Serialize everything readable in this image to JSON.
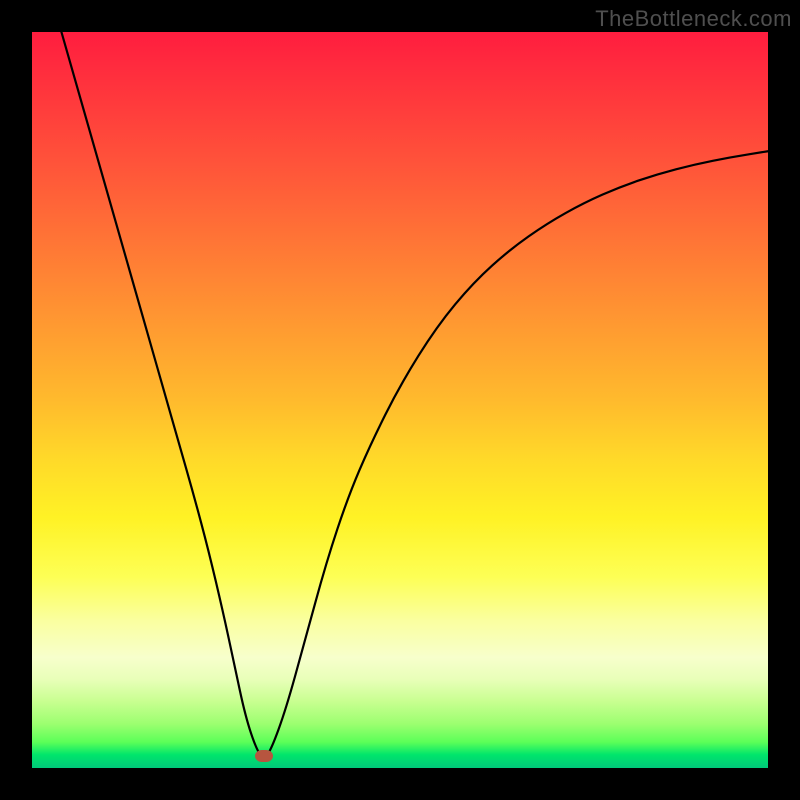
{
  "watermark": "TheBottleneck.com",
  "chart_data": {
    "type": "line",
    "title": "",
    "xlabel": "",
    "ylabel": "",
    "xlim": [
      0,
      100
    ],
    "ylim": [
      0,
      100
    ],
    "grid": false,
    "legend": false,
    "gradient_stops": [
      {
        "pos": 0,
        "color": "#ff1d3f"
      },
      {
        "pos": 50,
        "color": "#ffba2d"
      },
      {
        "pos": 74,
        "color": "#fdff55"
      },
      {
        "pos": 96.5,
        "color": "#5bff58"
      },
      {
        "pos": 100,
        "color": "#00c97a"
      }
    ],
    "series": [
      {
        "name": "bottleneck-curve",
        "x": [
          4,
          6,
          8,
          10,
          12,
          14,
          16,
          18,
          20,
          22,
          24,
          26,
          27.5,
          29,
          30.5,
          31.5,
          32.5,
          34.5,
          37,
          40,
          43,
          46,
          50,
          55,
          60,
          65,
          70,
          75,
          80,
          85,
          90,
          95,
          100
        ],
        "y": [
          100,
          93,
          86,
          79,
          72,
          65,
          58,
          51,
          44,
          37,
          29.5,
          21,
          14,
          7,
          2.5,
          1.2,
          2.5,
          8,
          17,
          28,
          37,
          44,
          52,
          60,
          66,
          70.5,
          74,
          76.8,
          79,
          80.7,
          82,
          83,
          83.8
        ]
      }
    ],
    "marker": {
      "x": 31.5,
      "y": 1.6,
      "color": "#b7553f"
    }
  }
}
